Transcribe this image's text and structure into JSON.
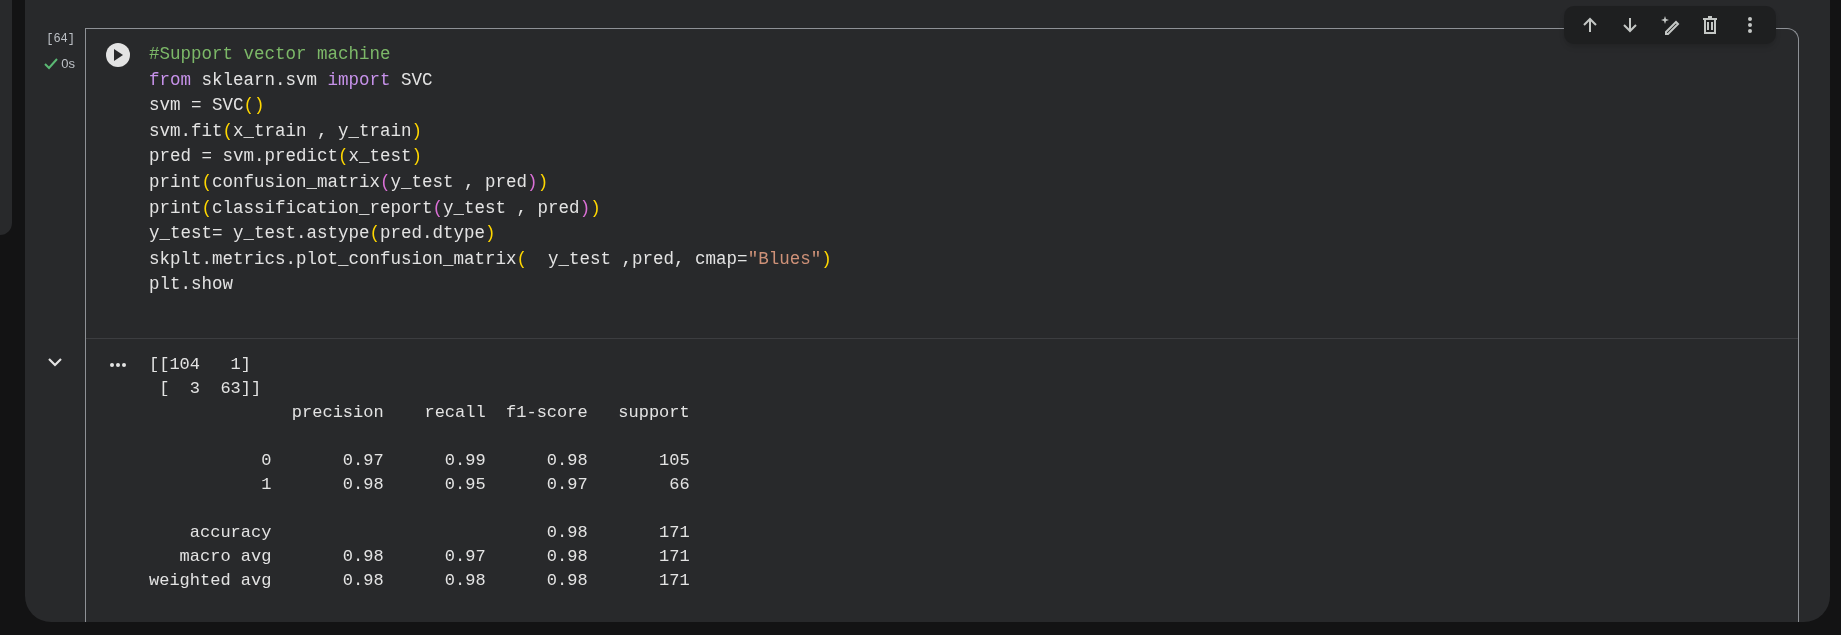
{
  "cell": {
    "execution_count": "[64]",
    "status": {
      "succeeded": true,
      "time": "0s"
    },
    "toolbar": [
      {
        "kind": "up"
      },
      {
        "kind": "down"
      },
      {
        "kind": "ai-edit"
      },
      {
        "kind": "delete"
      },
      {
        "kind": "more"
      }
    ],
    "code_lines": [
      [
        {
          "kind": "comment",
          "text": "#Support vector machine"
        }
      ],
      [
        {
          "kind": "keyword",
          "text": "from"
        },
        {
          "kind": "plain",
          "text": " sklearn.svm "
        },
        {
          "kind": "keyword",
          "text": "import"
        },
        {
          "kind": "plain",
          "text": " SVC"
        }
      ],
      [
        {
          "kind": "plain",
          "text": "svm = SVC"
        },
        {
          "kind": "paren",
          "text": "()"
        }
      ],
      [
        {
          "kind": "plain",
          "text": "svm.fit"
        },
        {
          "kind": "paren",
          "text": "("
        },
        {
          "kind": "plain",
          "text": "x_train , y_train"
        },
        {
          "kind": "paren",
          "text": ")"
        }
      ],
      [
        {
          "kind": "plain",
          "text": "pred = svm.predict"
        },
        {
          "kind": "paren",
          "text": "("
        },
        {
          "kind": "plain",
          "text": "x_test"
        },
        {
          "kind": "paren",
          "text": ")"
        }
      ],
      [
        {
          "kind": "plain",
          "text": "print"
        },
        {
          "kind": "paren",
          "text": "("
        },
        {
          "kind": "plain",
          "text": "confusion_matrix"
        },
        {
          "kind": "paren2",
          "text": "("
        },
        {
          "kind": "plain",
          "text": "y_test , pred"
        },
        {
          "kind": "paren2",
          "text": ")"
        },
        {
          "kind": "paren",
          "text": ")"
        }
      ],
      [
        {
          "kind": "plain",
          "text": "print"
        },
        {
          "kind": "paren",
          "text": "("
        },
        {
          "kind": "plain",
          "text": "classification_report"
        },
        {
          "kind": "paren2",
          "text": "("
        },
        {
          "kind": "plain",
          "text": "y_test , pred"
        },
        {
          "kind": "paren2",
          "text": ")"
        },
        {
          "kind": "paren",
          "text": ")"
        }
      ],
      [
        {
          "kind": "plain",
          "text": "y_test= y_test.astype"
        },
        {
          "kind": "paren",
          "text": "("
        },
        {
          "kind": "plain",
          "text": "pred.dtype"
        },
        {
          "kind": "paren",
          "text": ")"
        }
      ],
      [
        {
          "kind": "plain",
          "text": "skplt.metrics.plot_confusion_matrix"
        },
        {
          "kind": "paren",
          "text": "("
        },
        {
          "kind": "plain",
          "text": "  y_test ,pred, cmap="
        },
        {
          "kind": "string",
          "text": "\"Blues\""
        },
        {
          "kind": "paren",
          "text": ")"
        }
      ],
      [
        {
          "kind": "plain",
          "text": "plt.show"
        }
      ]
    ],
    "output": {
      "expanded": true,
      "text": "[[104   1]\n [  3  63]]\n              precision    recall  f1-score   support\n\n           0       0.97      0.99      0.98       105\n           1       0.98      0.95      0.97        66\n\n    accuracy                           0.98       171\n   macro avg       0.98      0.97      0.98       171\nweighted avg       0.98      0.98      0.98       171"
    }
  }
}
